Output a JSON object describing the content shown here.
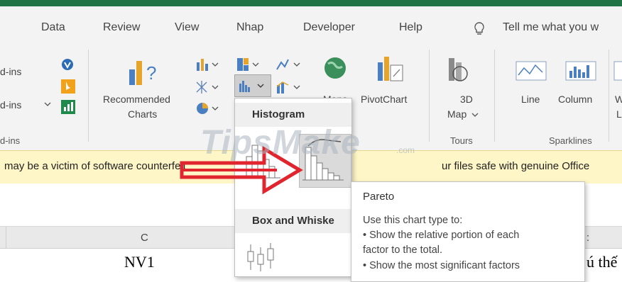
{
  "tabs": [
    "Data",
    "Review",
    "View",
    "Nhap",
    "Developer",
    "Help",
    "Tell me what you w"
  ],
  "ribbon": {
    "addins_row1": "d-ins",
    "addins_row2": "d-ins",
    "addins_group": "d-ins",
    "recommended_line1": "Recommended",
    "recommended_line2": "Charts",
    "maps_label": "Maps",
    "pivotchart_label": "PivotChart",
    "map3d_line1": "3D",
    "map3d_line2": "Map",
    "tours_group": "Tours",
    "spark_line": "Line",
    "spark_column": "Column",
    "spark_w": "W",
    "spark_l": "L",
    "sparklines_group": "Sparklines"
  },
  "warning": {
    "left_text": "may be a victim of software counterfeit",
    "right_text": "ur files safe with genuine Office"
  },
  "dropdown": {
    "histogram_header": "Histogram",
    "box_header": "Box and Whiske"
  },
  "tooltip": {
    "title": "Pareto",
    "lines": [
      "Use this chart type to:",
      "• Show the relative portion of each",
      "factor to the total.",
      "• Show the most significant factors"
    ]
  },
  "sheet": {
    "col_c": "C",
    "col_e_partial": ":",
    "cell_nv1": "NV1",
    "cell_right_partial": "ú thế"
  },
  "watermark": {
    "main": "TipsMake",
    "suffix": ".com"
  },
  "colors": {
    "excel_green": "#217346",
    "warning_bg": "#fff6c7",
    "arrow_red": "#e0252f"
  }
}
